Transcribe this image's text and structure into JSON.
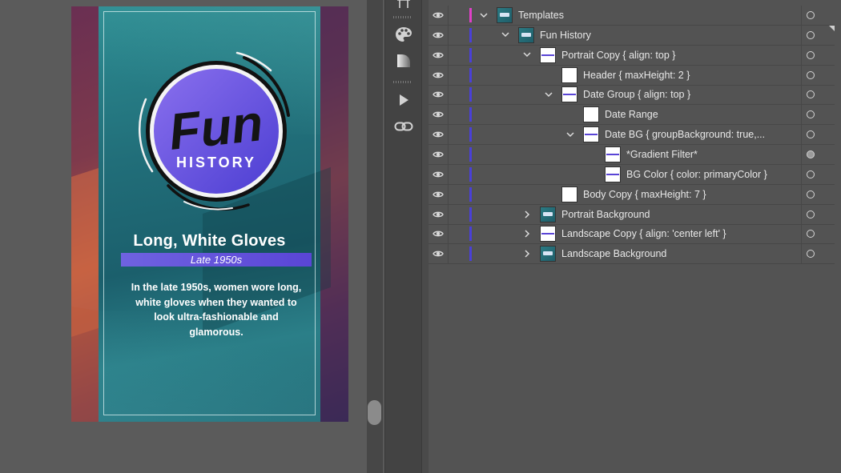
{
  "card": {
    "logo_word": "Fun",
    "logo_sub": "HISTORY",
    "title": "Long, White Gloves",
    "date": "Late 1950s",
    "body": "In the late 1950s, women wore long, white gloves when they wanted to look ultra-fashionable and glamorous."
  },
  "toolbar": {
    "tools": [
      "artboard-tool-icon",
      "color-palette-icon",
      "gradient-swatch-icon",
      "play-icon",
      "link-icon"
    ]
  },
  "layers": {
    "rows": [
      {
        "label": "Templates",
        "expanded": true,
        "bar_color": "#e040c8"
      },
      {
        "label": "Fun History",
        "expanded": true,
        "bar_color": "#4a40d8"
      },
      {
        "label": "Portrait Copy { align: top }",
        "expanded": true,
        "bar_color": "#4a40d8"
      },
      {
        "label": "Header { maxHeight: 2 }",
        "expanded": null,
        "bar_color": "#4a40d8"
      },
      {
        "label": "Date Group { align: top }",
        "expanded": true,
        "bar_color": "#4a40d8"
      },
      {
        "label": "Date Range",
        "expanded": null,
        "bar_color": "#4a40d8"
      },
      {
        "label": "Date BG { groupBackground: true,...",
        "expanded": true,
        "bar_color": "#4a40d8"
      },
      {
        "label": "*Gradient Filter*",
        "expanded": null,
        "bar_color": "#4a40d8",
        "target_filled": true
      },
      {
        "label": "BG Color { color: primaryColor }",
        "expanded": null,
        "bar_color": "#4a40d8"
      },
      {
        "label": "Body Copy { maxHeight: 7 }",
        "expanded": null,
        "bar_color": "#4a40d8"
      },
      {
        "label": "Portrait Background",
        "expanded": false,
        "bar_color": "#4a40d8"
      },
      {
        "label": "Landscape Copy { align: 'center left' }",
        "expanded": false,
        "bar_color": "#4a40d8"
      },
      {
        "label": "Landscape Background",
        "expanded": false,
        "bar_color": "#4a40d8"
      }
    ]
  },
  "colors": {
    "accent": "#5a45d6",
    "layer_bar": "#4a40d8",
    "top_layer_bar": "#e040c8"
  }
}
